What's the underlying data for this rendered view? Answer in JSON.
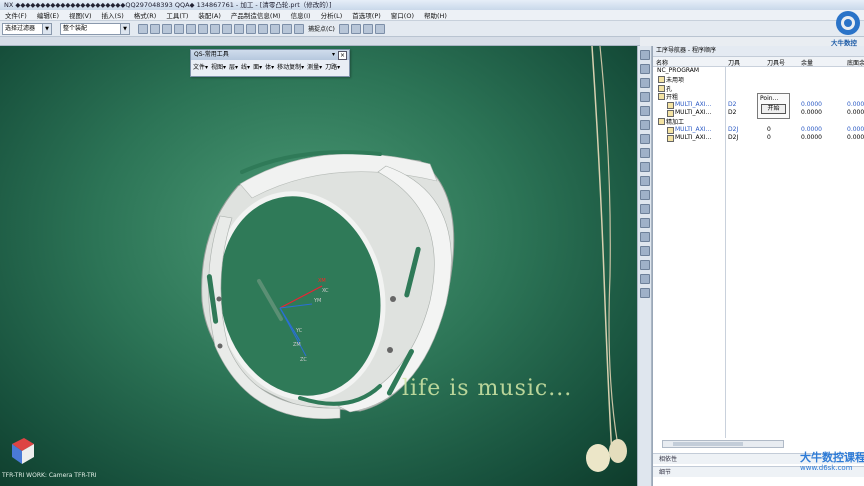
{
  "window": {
    "title": "NX ◆◆◆◆◆◆◆◆◆◆◆◆◆◆◆◆◆◆◆◆◆◆QQ297048393 QQA◆ 134867761 - 加工 - [清零凸轮.prt（修改的）]"
  },
  "menubar": [
    "文件(F)",
    "编辑(E)",
    "视图(V)",
    "插入(S)",
    "格式(R)",
    "工具(T)",
    "装配(A)",
    "产品制造信息(M)",
    "信息(I)",
    "分析(L)",
    "首选项(P)",
    "窗口(O)",
    "帮助(H)"
  ],
  "toolbar": {
    "filter_value": "选择过滤器",
    "assembly_value": "整个装配",
    "capture_label": "捕捉点(C)"
  },
  "qs_panel": {
    "title": "QS-常用工具",
    "menus": [
      "文件▾",
      "视图▾",
      "层▾",
      "线▾",
      "面▾",
      "体▾",
      "移动复制▾",
      "测量▾",
      "刀路▾"
    ]
  },
  "viewport": {
    "overlay_text": "life is music...",
    "wcs_label": "TFR-TRI WORK: Camera TFR-TRI",
    "axis_labels": [
      "XM",
      "YM",
      "ZM",
      "XC",
      "YC",
      "ZC"
    ]
  },
  "navigator": {
    "title": "工序导航器 - 程序顺序",
    "columns": [
      "名称",
      "刀具",
      "刀具号",
      "余量",
      "底面余"
    ],
    "rows": [
      {
        "name": "NC_PROGRAM",
        "tool": "",
        "tool_no": "",
        "stock": "",
        "floor": "",
        "level": 0,
        "blue": false
      },
      {
        "name": "未用项",
        "tool": "",
        "tool_no": "",
        "stock": "",
        "floor": "",
        "level": 1,
        "blue": false
      },
      {
        "name": "孔",
        "tool": "",
        "tool_no": "",
        "stock": "",
        "floor": "",
        "level": 1,
        "blue": false
      },
      {
        "name": "开粗",
        "tool": "",
        "tool_no": "",
        "stock": "",
        "floor": "",
        "level": 1,
        "blue": false
      },
      {
        "name": "MULTI_AXI...",
        "tool": "D2",
        "tool_no": "0",
        "stock": "0.0000",
        "floor": "0.0000",
        "level": 2,
        "blue": true
      },
      {
        "name": "MULTI_AXI...",
        "tool": "D2",
        "tool_no": "0",
        "stock": "0.0000",
        "floor": "0.0000",
        "level": 2,
        "blue": false
      },
      {
        "name": "精加工",
        "tool": "",
        "tool_no": "",
        "stock": "",
        "floor": "",
        "level": 1,
        "blue": false
      },
      {
        "name": "MULTI_AXI...",
        "tool": "D2J",
        "tool_no": "0",
        "stock": "0.0000",
        "floor": "0.0000",
        "level": 2,
        "blue": true
      },
      {
        "name": "MULTI_AXI...",
        "tool": "D2J",
        "tool_no": "0",
        "stock": "0.0000",
        "floor": "0.0000",
        "level": 2,
        "blue": false
      }
    ],
    "tooltip": {
      "title": "Poin...",
      "button": "开始"
    },
    "footer": [
      "相依性",
      "细节"
    ]
  },
  "branding": {
    "logo_text": "大牛数控",
    "watermark_title": "大牛数控课程",
    "watermark_url": "www.d6sk.com"
  },
  "colors": {
    "viewport_green": "#2c7456",
    "ring_white": "#eef0ee",
    "link_blue": "#2a59c4"
  }
}
